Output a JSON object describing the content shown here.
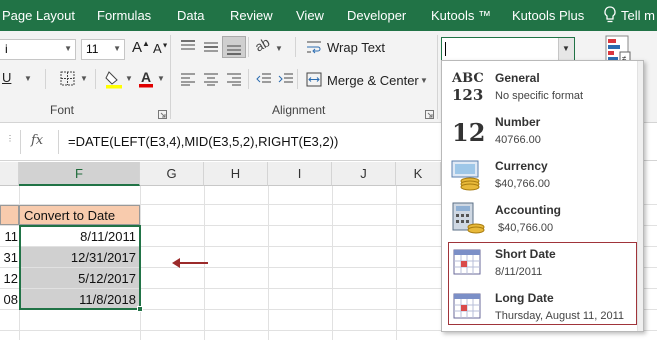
{
  "ribbon": {
    "tabs": [
      "Page Layout",
      "Formulas",
      "Data",
      "Review",
      "View",
      "Developer",
      "Kutools ™",
      "Kutools Plus",
      "Tell m"
    ],
    "font_name": "i",
    "font_size": "11",
    "wrap_text": "Wrap Text",
    "merge_center": "Merge & Center",
    "font_group": "Font",
    "alignment_group": "Alignment",
    "number_format_value": ""
  },
  "formula_bar": {
    "fx": "fx",
    "formula": "=DATE(LEFT(E3,4),MID(E3,5,2),RIGHT(E3,2))"
  },
  "grid": {
    "columns": [
      "F",
      "G",
      "H",
      "I",
      "J",
      "K"
    ],
    "header_cell": "Convert to Date",
    "left_fragments": [
      "11",
      "31",
      "12",
      "08"
    ],
    "dates": [
      "8/11/2011",
      "12/31/2017",
      "5/12/2017",
      "11/8/2018"
    ]
  },
  "number_formats": [
    {
      "name": "General",
      "example": "No specific format",
      "icon": "abc-123-icon"
    },
    {
      "name": "Number",
      "example": "40766.00",
      "icon": "number-12-icon"
    },
    {
      "name": "Currency",
      "example": "$40,766.00",
      "icon": "currency-icon"
    },
    {
      "name": "Accounting",
      "example": " $40,766.00",
      "icon": "accounting-icon"
    },
    {
      "name": "Short Date",
      "example": "8/11/2011",
      "icon": "calendar-icon"
    },
    {
      "name": "Long Date",
      "example": "Thursday, August 11, 2011",
      "icon": "calendar-icon"
    }
  ],
  "colors": {
    "ribbon_green": "#217346",
    "highlight_border": "#a0343a",
    "arrow": "#9b2a2a",
    "header_fill": "#f8cbad",
    "selected_cells": "#d0d0d0"
  }
}
